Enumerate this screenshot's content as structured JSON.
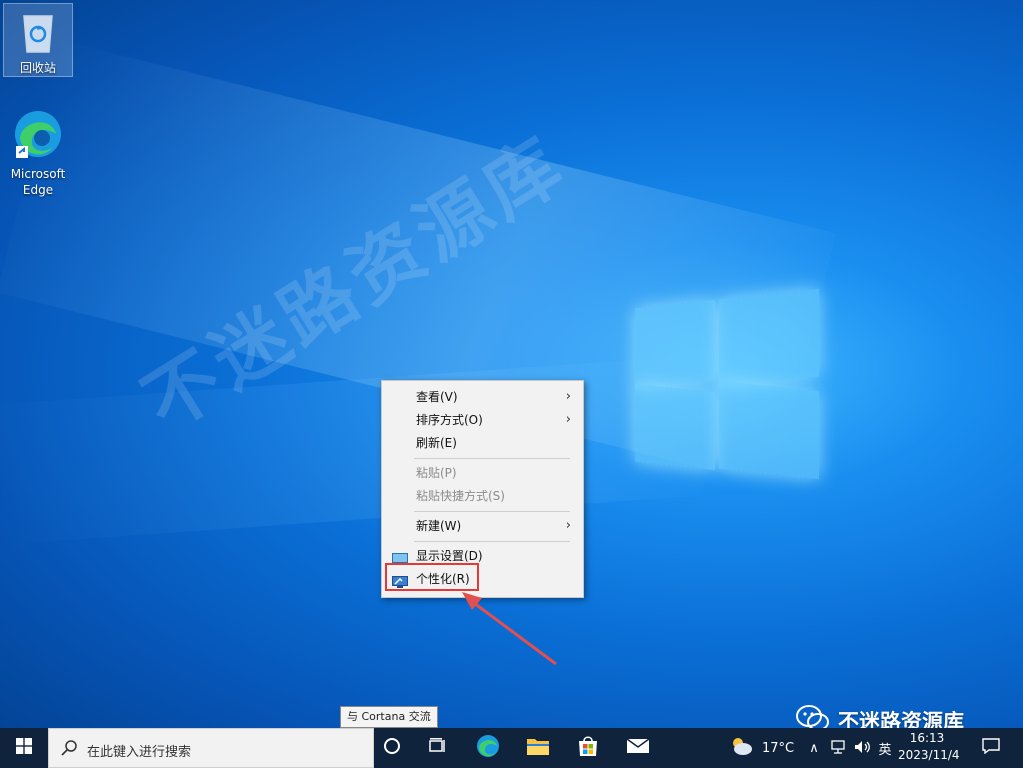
{
  "desktop": {
    "icons": [
      {
        "label": "回收站",
        "icon": "recycle-bin-icon"
      },
      {
        "label_line1": "Microsoft",
        "label_line2": "Edge",
        "icon": "edge-icon"
      }
    ],
    "watermark": "不迷路资源库"
  },
  "context_menu": {
    "items": [
      {
        "label": "查看(V)",
        "submenu": true
      },
      {
        "label": "排序方式(O)",
        "submenu": true
      },
      {
        "label": "刷新(E)"
      },
      {
        "label": "粘贴(P)",
        "disabled": true
      },
      {
        "label": "粘贴快捷方式(S)",
        "disabled": true
      },
      {
        "label": "新建(W)",
        "submenu": true
      },
      {
        "label": "显示设置(D)",
        "icon": "display-settings-icon"
      },
      {
        "label": "个性化(R)",
        "icon": "personalize-icon",
        "highlighted": true
      }
    ],
    "highlight_color": "#e53935"
  },
  "tooltip": {
    "text": "与 Cortana 交流"
  },
  "wechat_overlay": {
    "text": "不迷路资源库",
    "icon": "wechat-icon"
  },
  "taskbar": {
    "search_placeholder": "在此键入进行搜索",
    "pinned": [
      "cortana-icon",
      "task-view-icon",
      "edge-icon",
      "file-explorer-icon",
      "store-icon",
      "mail-icon"
    ],
    "weather": {
      "temp": "17°C",
      "icon": "weather-partly-cloudy-icon"
    },
    "tray": {
      "ime": "英"
    },
    "clock": {
      "time": "16:13",
      "date": "2023/11/4"
    },
    "accent": "#10233d"
  }
}
